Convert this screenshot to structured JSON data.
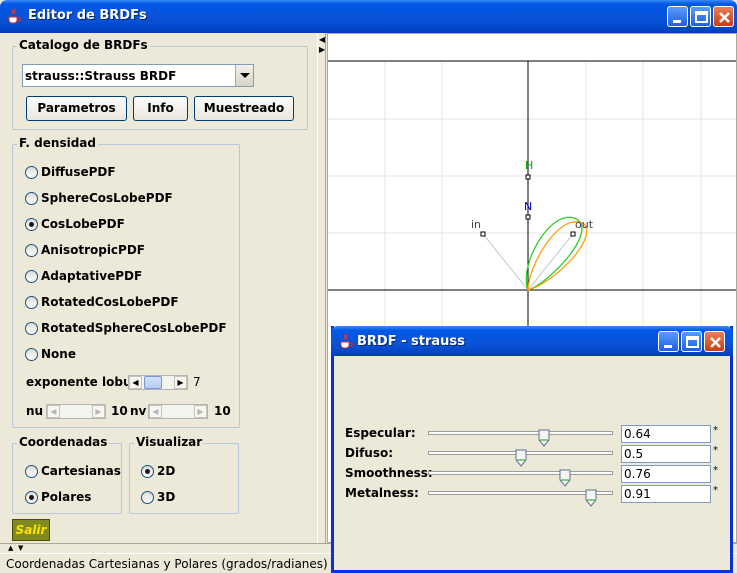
{
  "window": {
    "title": "Editor de BRDFs"
  },
  "catalog": {
    "group_title": "Catalogo de BRDFs",
    "selected": "strauss::Strauss BRDF",
    "buttons": {
      "parametros": "Parametros",
      "info": "Info",
      "muestreado": "Muestreado"
    }
  },
  "density": {
    "group_title": "F. densidad",
    "options": [
      "DiffusePDF",
      "SphereCosLobePDF",
      "CosLobePDF",
      "AnisotropicPDF",
      "AdaptativePDF",
      "RotatedCosLobePDF",
      "RotatedSphereCosLobePDF",
      "None"
    ],
    "selected_index": 2,
    "exponent_label": "exponente lobulo",
    "exponent_value": "7",
    "nu_label": "nu",
    "nu_value": "10",
    "nv_label": "nv",
    "nv_value": "10"
  },
  "coords": {
    "group_title": "Coordenadas",
    "options": [
      "Cartesianas",
      "Polares"
    ],
    "selected": "Polares"
  },
  "visualize": {
    "group_title": "Visualizar",
    "options": [
      "2D",
      "3D"
    ],
    "selected": "2D"
  },
  "exit_label": "Salir",
  "status_bar": "Coordenadas Cartesianas y Polares (grados/radianes)",
  "plot": {
    "labels": {
      "h": "H",
      "n": "N",
      "in": "in",
      "out": "out"
    },
    "colors": {
      "lobe_green": "#22cc22",
      "lobe_orange": "#ff9900",
      "h_label": "#00aa00",
      "n_label": "#0000cc"
    }
  },
  "brdf_dialog": {
    "title": "BRDF - strauss",
    "params": [
      {
        "label": "Especular:",
        "value": "0.64",
        "fraction": 0.64
      },
      {
        "label": "Difuso:",
        "value": "0.5",
        "fraction": 0.5
      },
      {
        "label": "Smoothness:",
        "value": "0.76",
        "fraction": 0.76
      },
      {
        "label": "Metalness:",
        "value": "0.91",
        "fraction": 0.91
      }
    ],
    "modified_marker": "*"
  },
  "icons": [
    "java-cup-icon",
    "minimize-icon",
    "maximize-icon",
    "close-icon",
    "dropdown-arrow-icon",
    "scroll-left-icon",
    "scroll-right-icon"
  ]
}
